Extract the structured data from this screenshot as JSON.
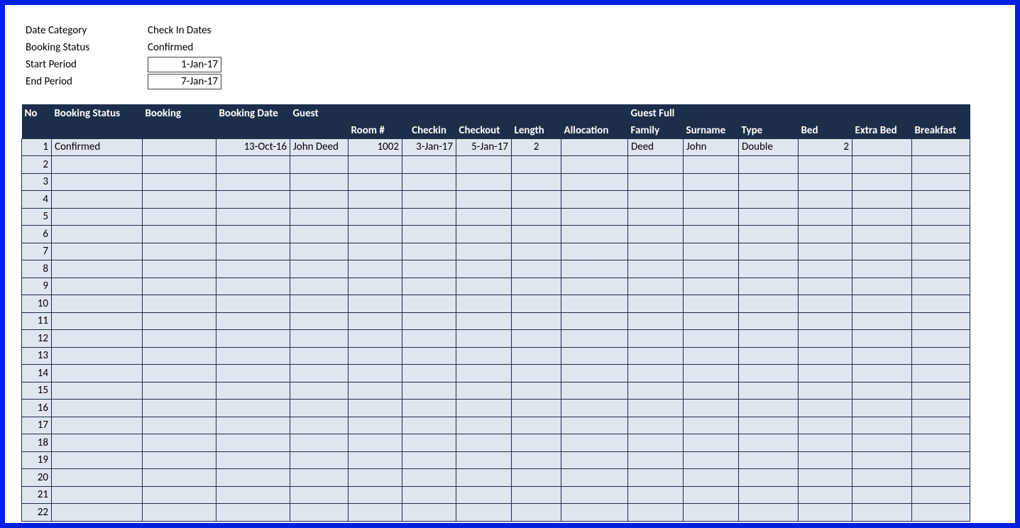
{
  "filters": {
    "date_category_label": "Date Category",
    "date_category_value": "Check In Dates",
    "booking_status_label": "Booking Status",
    "booking_status_value": "Confirmed",
    "start_period_label": "Start Period",
    "start_period_value": "1-Jan-17",
    "end_period_label": "End Period",
    "end_period_value": "7-Jan-17"
  },
  "columns": {
    "no": "No",
    "booking_status": "Booking Status",
    "booking": "Booking",
    "booking_date": "Booking Date",
    "guest": "Guest",
    "room": "Room #",
    "checkin": "Checkin",
    "checkout": "Checkout",
    "length": "Length",
    "allocation": "Allocation",
    "guest_full": "Guest Full",
    "family": "Family",
    "surname": "Surname",
    "type": "Type",
    "bed": "Bed",
    "extra_bed": "Extra Bed",
    "breakfast": "Breakfast"
  },
  "rows": [
    {
      "no": "1",
      "booking_status": "Confirmed",
      "booking": "",
      "booking_date": "13-Oct-16",
      "guest": "John Deed",
      "room": "1002",
      "checkin": "3-Jan-17",
      "checkout": "5-Jan-17",
      "length": "2",
      "allocation": "",
      "family": "Deed",
      "surname": "John",
      "type": "Double",
      "bed": "2",
      "extra_bed": "",
      "breakfast": ""
    },
    {
      "no": "2"
    },
    {
      "no": "3"
    },
    {
      "no": "4"
    },
    {
      "no": "5"
    },
    {
      "no": "6"
    },
    {
      "no": "7"
    },
    {
      "no": "8"
    },
    {
      "no": "9"
    },
    {
      "no": "10"
    },
    {
      "no": "11"
    },
    {
      "no": "12"
    },
    {
      "no": "13"
    },
    {
      "no": "14"
    },
    {
      "no": "15"
    },
    {
      "no": "16"
    },
    {
      "no": "17"
    },
    {
      "no": "18"
    },
    {
      "no": "19"
    },
    {
      "no": "20"
    },
    {
      "no": "21"
    },
    {
      "no": "22"
    }
  ]
}
